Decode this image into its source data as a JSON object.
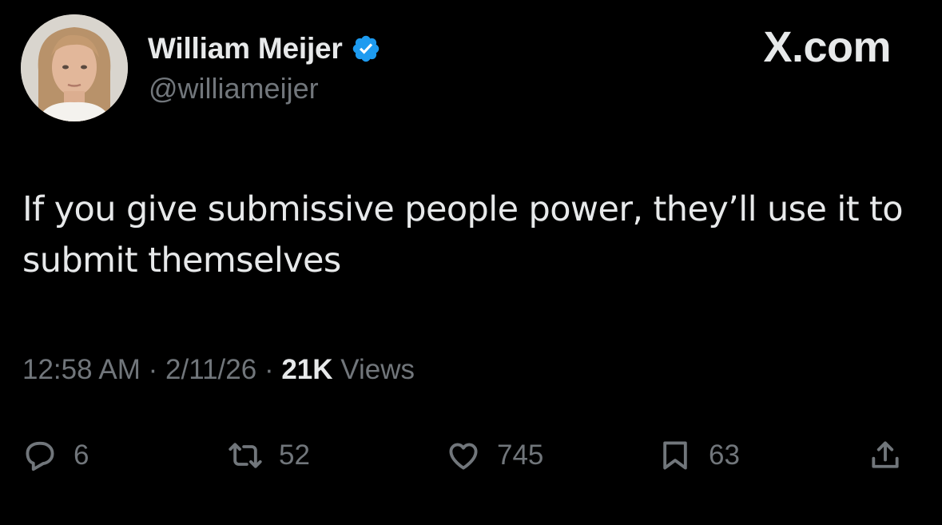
{
  "author": {
    "display_name": "William Meijer",
    "handle": "@williameijer",
    "verified": true,
    "avatar": "profile-photo"
  },
  "brand": {
    "label": "X.com"
  },
  "tweet": {
    "text": "If you give submissive people power, they’ll use it to submit themselves"
  },
  "meta": {
    "time": "12:58 AM",
    "separator": "·",
    "date": "2/11/26",
    "views_count": "21K",
    "views_label": "Views"
  },
  "actions": {
    "replies": {
      "icon": "reply-icon",
      "count": "6"
    },
    "reposts": {
      "icon": "repost-icon",
      "count": "52"
    },
    "likes": {
      "icon": "heart-icon",
      "count": "745"
    },
    "bookmarks": {
      "icon": "bookmark-icon",
      "count": "63"
    },
    "share": {
      "icon": "share-icon"
    }
  },
  "colors": {
    "background": "#000000",
    "primary_text": "#e7e9ea",
    "secondary_text": "#71767b",
    "verified_blue": "#1d9bf0"
  }
}
